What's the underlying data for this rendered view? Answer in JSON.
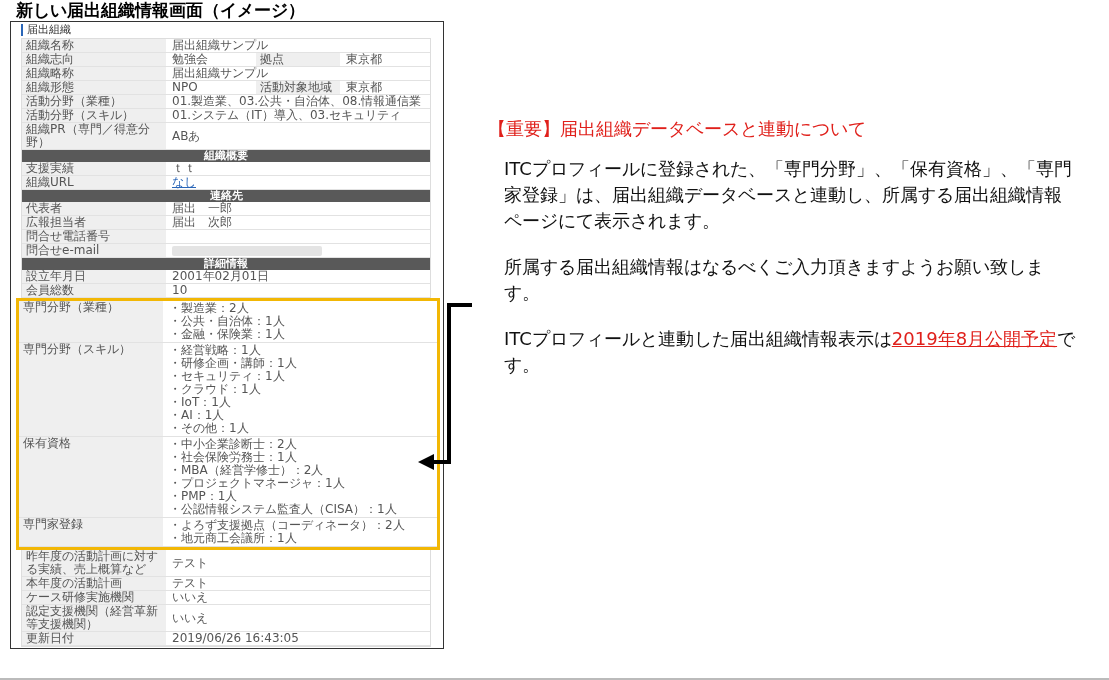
{
  "slide_title": "新しい届出組織情報画面（イメージ）",
  "form": {
    "section_label": "届出組織",
    "rows": [
      {
        "kind": "field",
        "cells": [
          {
            "label": "組織名称",
            "value": "届出組織サンプル"
          }
        ]
      },
      {
        "kind": "field",
        "cells": [
          {
            "label": "組織志向",
            "value": "勉強会"
          },
          {
            "label": "拠点",
            "value": "東京都"
          }
        ]
      },
      {
        "kind": "field",
        "cells": [
          {
            "label": "組織略称",
            "value": "届出組織サンプル"
          }
        ]
      },
      {
        "kind": "field",
        "cells": [
          {
            "label": "組織形態",
            "value": "NPO"
          },
          {
            "label": "活動対象地域",
            "value": "東京都"
          }
        ]
      },
      {
        "kind": "field",
        "cells": [
          {
            "label": "活動分野（業種）",
            "value": "01.製造業、03.公共・自治体、08.情報通信業"
          }
        ]
      },
      {
        "kind": "field",
        "cells": [
          {
            "label": "活動分野（スキル）",
            "value": "01.システム（IT）導入、03.セキュリティ"
          }
        ]
      },
      {
        "kind": "field",
        "cells": [
          {
            "label": "組織PR（専門／得意分野）",
            "value": "ABあ"
          }
        ]
      },
      {
        "kind": "header",
        "text": "組織概要"
      },
      {
        "kind": "field",
        "cells": [
          {
            "label": "支援実績",
            "value": "ｔｔ"
          }
        ]
      },
      {
        "kind": "link",
        "cells": [
          {
            "label": "組織URL",
            "value": "なし"
          }
        ]
      },
      {
        "kind": "header",
        "text": "連絡先"
      },
      {
        "kind": "field",
        "cells": [
          {
            "label": "代表者",
            "value": "届出　一郎"
          }
        ]
      },
      {
        "kind": "field",
        "cells": [
          {
            "label": "広報担当者",
            "value": "届出　次郎"
          }
        ]
      },
      {
        "kind": "field",
        "cells": [
          {
            "label": "問合せ電話番号"
          }
        ]
      },
      {
        "kind": "redacted",
        "cells": [
          {
            "label": "問合せe-mail"
          }
        ]
      },
      {
        "kind": "header",
        "text": "詳細情報"
      },
      {
        "kind": "field",
        "cells": [
          {
            "label": "設立年月日",
            "value": "2001年02月01日"
          }
        ]
      },
      {
        "kind": "field",
        "cells": [
          {
            "label": "会員総数",
            "value": "10"
          }
        ]
      }
    ],
    "highlighted_rows": [
      {
        "label": "専門分野（業種）",
        "items": [
          "・製造業：2人",
          "・公共・自治体：1人",
          "・金融・保険業：1人"
        ]
      },
      {
        "label": "専門分野（スキル）",
        "items": [
          "・経営戦略：1人",
          "・研修企画・講師：1人",
          "・セキュリティ：1人",
          "・クラウド：1人",
          "・IoT：1人",
          "・AI：1人",
          "・その他：1人"
        ]
      },
      {
        "label": "保有資格",
        "items": [
          "・中小企業診断士：2人",
          "・社会保険労務士：1人",
          "・MBA（経営学修士）：2人",
          "・プロジェクトマネージャ：1人",
          "・PMP：1人",
          "・公認情報システム監査人（CISA）：1人"
        ]
      },
      {
        "label": "専門家登録",
        "items": [
          "・よろず支援拠点（コーディネータ）：2人",
          "・地元商工会議所：1人"
        ]
      }
    ],
    "rows_after": [
      {
        "label": "昨年度の活動計画に対する実績、売上概算など",
        "value": "テスト"
      },
      {
        "label": "本年度の活動計画",
        "value": "テスト"
      },
      {
        "label": "ケース研修実施機関",
        "value": "いいえ"
      },
      {
        "label": "認定支援機関（経営革新等支援機関）",
        "value": "いいえ"
      },
      {
        "label": "更新日付",
        "value": "2019/06/26 16:43:05"
      }
    ]
  },
  "notice": {
    "heading": "【重要】届出組織データベースと連動について",
    "paragraphs": [
      [
        {
          "text": "ITCプロフィールに登録された、「専門分野」、「保有資格」、「専門家登録」は、届出組織データベースと連動し、所属する届出組織情報ページにて表示されます。",
          "emphasis": false
        }
      ],
      [
        {
          "text": "所属する届出組織情報はなるべくご入力頂きますようお願い致します。",
          "emphasis": false
        }
      ],
      [
        {
          "text": "ITCプロフィールと連動した届出組織情報表示は",
          "emphasis": false
        },
        {
          "text": "2019年8月公開予定",
          "emphasis": true
        },
        {
          "text": "です。",
          "emphasis": false
        }
      ]
    ]
  }
}
